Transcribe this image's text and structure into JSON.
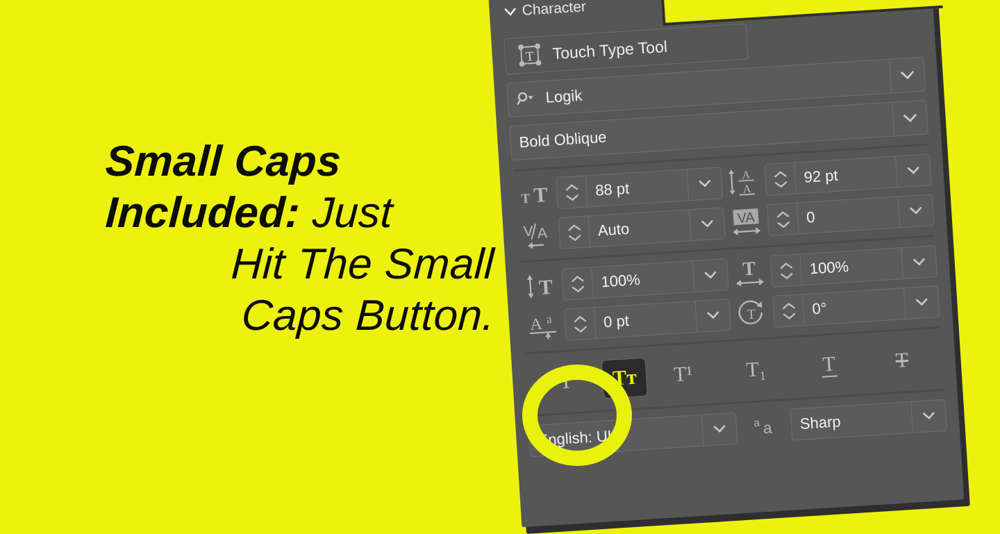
{
  "background_color": "#ecf20d",
  "promo": {
    "line1": "Small Caps",
    "line2a": "Included:",
    "line2b": "Just",
    "line3": "Hit The Small",
    "line4": "Caps Button."
  },
  "panel": {
    "title": "Character",
    "accent_color": "#e9f20d",
    "panel_bg": "#565656",
    "touch_type_tool": {
      "label": "Touch Type Tool",
      "icon": "touch-type-tool-icon"
    },
    "font_family": {
      "value": "Logik",
      "icon": "search-icon",
      "chevron": "chevron-down-icon"
    },
    "font_style": {
      "value": "Bold Oblique",
      "chevron": "chevron-down-icon"
    },
    "fields": [
      {
        "name": "font-size",
        "icon": "font-size-icon",
        "icon_glyph": "tT",
        "value": "88 pt"
      },
      {
        "name": "leading",
        "icon": "leading-icon",
        "icon_glyph": "A/A",
        "value": "92 pt"
      },
      {
        "name": "kerning",
        "icon": "kerning-icon",
        "icon_glyph": "V/A",
        "value": "Auto"
      },
      {
        "name": "tracking",
        "icon": "tracking-icon",
        "icon_glyph": "VA",
        "value": "0"
      },
      {
        "name": "vertical-scale",
        "icon": "vertical-scale-icon",
        "icon_glyph": "T",
        "value": "100%"
      },
      {
        "name": "horizontal-scale",
        "icon": "horizontal-scale-icon",
        "icon_glyph": "T",
        "value": "100%"
      },
      {
        "name": "baseline-shift",
        "icon": "baseline-shift-icon",
        "icon_glyph": "Aa",
        "value": "0 pt"
      },
      {
        "name": "character-rotation",
        "icon": "character-rotation-icon",
        "icon_glyph": "T",
        "value": "0°"
      }
    ],
    "style_buttons": [
      {
        "name": "all-caps",
        "glyph": "T",
        "active": false
      },
      {
        "name": "small-caps",
        "glyph": "Tᴛ",
        "active": true
      },
      {
        "name": "superscript",
        "glyph": "T¹",
        "active": false
      },
      {
        "name": "subscript",
        "glyph": "T₁",
        "active": false
      },
      {
        "name": "underline",
        "glyph": "T",
        "active": false
      },
      {
        "name": "strikethrough",
        "glyph": "T",
        "active": false
      }
    ],
    "language": {
      "value": "English: UK",
      "chevron": "chevron-down-icon"
    },
    "anti_aliasing": {
      "icon": "anti-alias-icon",
      "icon_glyph": "ᵃa",
      "value": "Sharp",
      "chevron": "chevron-down-icon"
    }
  }
}
